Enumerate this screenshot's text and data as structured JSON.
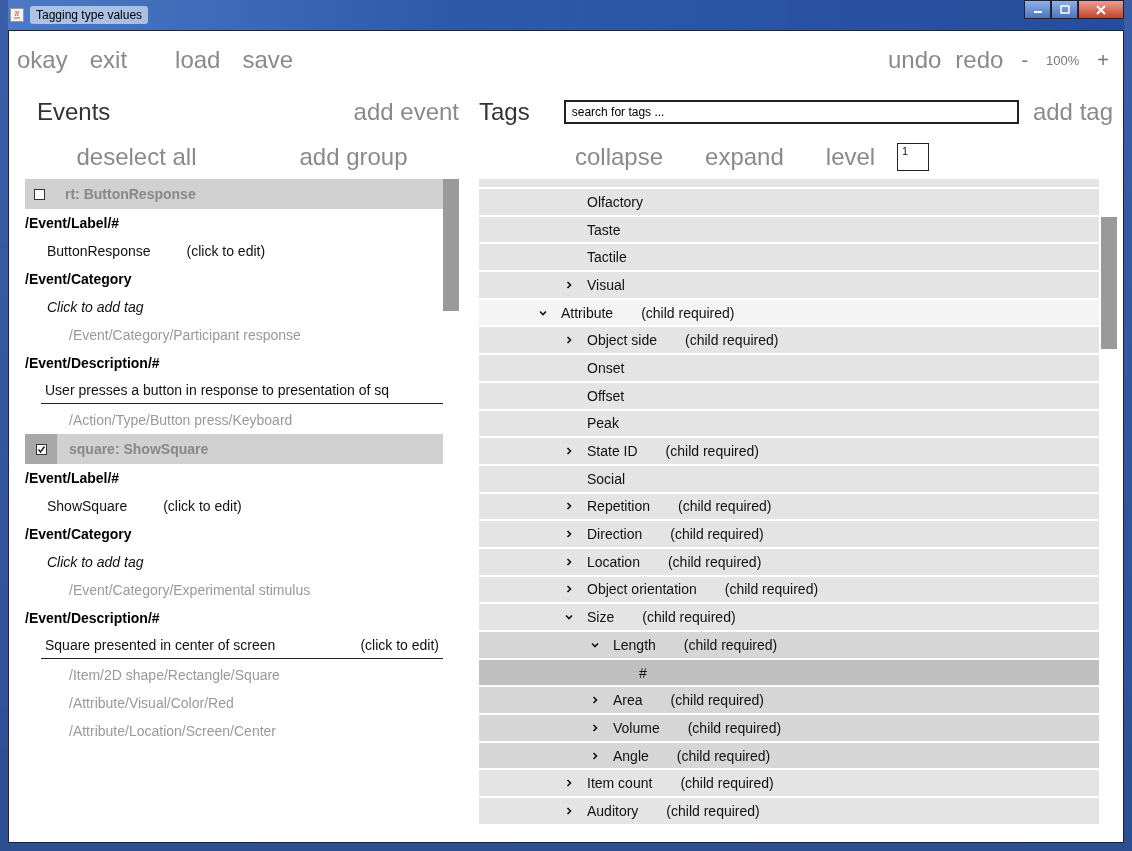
{
  "window": {
    "title": "Tagging type values"
  },
  "toolbar": {
    "left": [
      "okay",
      "exit",
      "load",
      "save"
    ],
    "right": [
      "undo",
      "redo"
    ],
    "zoom": {
      "minus": "-",
      "value": "100%",
      "plus": "+"
    }
  },
  "events_panel": {
    "title": "Events",
    "add_event": "add event",
    "deselect_all": "deselect all",
    "add_group": "add group",
    "events": [
      {
        "name": "rt: ButtonResponse",
        "checked": false,
        "sections": [
          {
            "heading": "/Event/Label/#",
            "entries": [
              {
                "kind": "editable",
                "text": "ButtonResponse",
                "hint": "(click to edit)"
              }
            ]
          },
          {
            "heading": "/Event/Category",
            "entries": [
              {
                "kind": "add",
                "text": "Click to add tag"
              },
              {
                "kind": "tag",
                "text": "/Event/Category/Participant response"
              }
            ]
          },
          {
            "heading": "/Event/Description/#",
            "entries": [
              {
                "kind": "description",
                "text": "User presses a button in response to presentation of sq"
              },
              {
                "kind": "tag",
                "text": "/Action/Type/Button press/Keyboard"
              }
            ]
          }
        ]
      },
      {
        "name": "square: ShowSquare",
        "checked": true,
        "sections": [
          {
            "heading": "/Event/Label/#",
            "entries": [
              {
                "kind": "editable",
                "text": "ShowSquare",
                "hint": "(click to edit)"
              }
            ]
          },
          {
            "heading": "/Event/Category",
            "entries": [
              {
                "kind": "add",
                "text": "Click to add tag"
              },
              {
                "kind": "tag",
                "text": "/Event/Category/Experimental stimulus"
              }
            ]
          },
          {
            "heading": "/Event/Description/#",
            "entries": [
              {
                "kind": "description",
                "text": "Square presented in center of screen",
                "hint": "(click to edit)"
              },
              {
                "kind": "tag",
                "text": "/Item/2D shape/Rectangle/Square"
              },
              {
                "kind": "tag",
                "text": "/Attribute/Visual/Color/Red"
              },
              {
                "kind": "tag",
                "text": "/Attribute/Location/Screen/Center"
              }
            ]
          }
        ]
      }
    ]
  },
  "tags_panel": {
    "title": "Tags",
    "search": {
      "placeholder": "search for tags ..."
    },
    "add_tag": "add tag",
    "collapse": "collapse",
    "expand": "expand",
    "level_label": "level",
    "level_value": "1",
    "continued_children": [
      {
        "label": "Olfactory"
      },
      {
        "label": "Taste"
      },
      {
        "label": "Tactile"
      },
      {
        "label": "Visual",
        "expanded": false
      }
    ],
    "items": [
      {
        "label": "Attribute",
        "hint": "(child required)",
        "expanded": true,
        "children": [
          {
            "label": "Object side",
            "hint": "(child required)",
            "expanded": false
          },
          {
            "label": "Onset"
          },
          {
            "label": "Offset"
          },
          {
            "label": "Peak"
          },
          {
            "label": "State ID",
            "hint": "(child required)",
            "expanded": false
          },
          {
            "label": "Social"
          },
          {
            "label": "Repetition",
            "hint": "(child required)",
            "expanded": false
          },
          {
            "label": "Direction",
            "hint": "(child required)",
            "expanded": false
          },
          {
            "label": "Location",
            "hint": "(child required)",
            "expanded": false
          },
          {
            "label": "Object orientation",
            "hint": "(child required)",
            "expanded": false
          },
          {
            "label": "Size",
            "hint": "(child required)",
            "expanded": true,
            "children": [
              {
                "label": "Length",
                "hint": "(child required)",
                "expanded": true,
                "children": [
                  {
                    "label": "#"
                  }
                ]
              },
              {
                "label": "Area",
                "hint": "(child required)",
                "expanded": false
              },
              {
                "label": "Volume",
                "hint": "(child required)",
                "expanded": false
              },
              {
                "label": "Angle",
                "hint": "(child required)",
                "expanded": false
              }
            ]
          },
          {
            "label": "Item count",
            "hint": "(child required)",
            "expanded": false
          },
          {
            "label": "Auditory",
            "hint": "(child required)",
            "expanded": false
          }
        ]
      }
    ]
  }
}
